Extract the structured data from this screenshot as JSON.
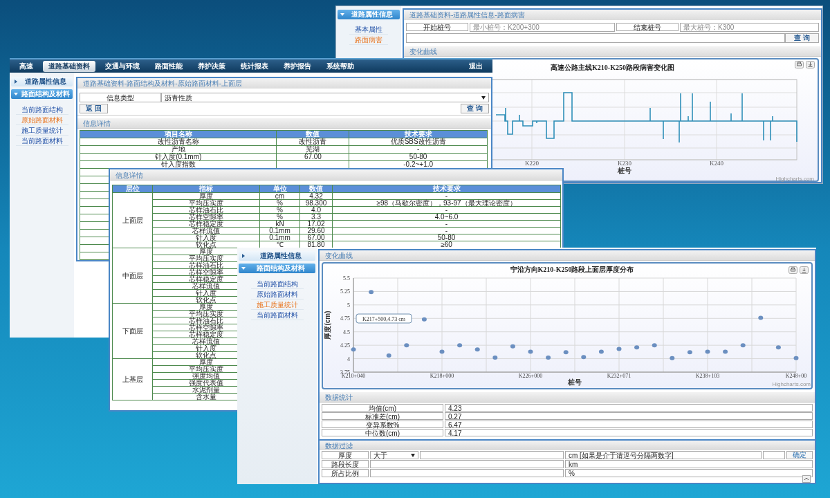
{
  "distress_window": {
    "sidebar": {
      "groups": [
        {
          "label": "道路属性信息",
          "expanded": true,
          "items": [
            {
              "label": "基本属性",
              "selected": false
            },
            {
              "label": "路面病害",
              "selected": true
            }
          ]
        }
      ]
    },
    "breadcrumb": "道路基础资料-道路属性信息-路面病害",
    "form": {
      "start_label": "开始桩号",
      "start_placeholder": "最小桩号：K200+300",
      "end_label": "结束桩号",
      "end_placeholder": "最大桩号：K300",
      "query_button": "查 询"
    },
    "section_title": "变化曲线",
    "chart": {
      "title": "高速公路主线K210-K250路段病害变化图",
      "x_labels": [
        "K220",
        "K230",
        "K240"
      ],
      "xlabel": "桩号",
      "credit": "Highcharts.com"
    }
  },
  "material_window": {
    "nav": [
      {
        "label": "高速",
        "selected": false
      },
      {
        "label": "道路基础资料",
        "selected": true
      },
      {
        "label": "交通与环境",
        "selected": false
      },
      {
        "label": "路面性能",
        "selected": false
      },
      {
        "label": "养护决策",
        "selected": false
      },
      {
        "label": "统计报表",
        "selected": false
      },
      {
        "label": "养护报告",
        "selected": false
      },
      {
        "label": "系统帮助",
        "selected": false
      }
    ],
    "logout": "退出",
    "sidebar": {
      "groups": [
        {
          "label": "道路属性信息",
          "expanded": false
        },
        {
          "label": "路面结构及材料",
          "expanded": true,
          "items": [
            {
              "label": "当前路面结构",
              "selected": false
            },
            {
              "label": "原始路面材料",
              "selected": true
            },
            {
              "label": "施工质量统计",
              "selected": false
            },
            {
              "label": "当前路面材料",
              "selected": false
            }
          ]
        }
      ]
    },
    "breadcrumb": "道路基础资料-路面结构及材料-原始路面材料-上面层",
    "filter": {
      "label": "信息类型",
      "value": "沥青性质"
    },
    "back_button": "返 回",
    "query_button": "查 询",
    "section_title": "信息详情",
    "table": {
      "columns": [
        "项目名称",
        "数值",
        "技术要求"
      ],
      "rows": [
        [
          "改性沥青名称",
          "改性沥青",
          "优质SBS改性沥青"
        ],
        [
          "产地",
          "芜湖",
          "-"
        ],
        [
          "针入度(0.1mm)",
          "67.00",
          "50-80"
        ],
        [
          "针入度指数",
          "",
          "-0.2~+1.0"
        ]
      ]
    }
  },
  "detail_window": {
    "section_title": "信息详情",
    "table": {
      "columns": [
        "层位",
        "指标",
        "单位",
        "数值",
        "技术要求"
      ],
      "groups": [
        {
          "layer": "上面层",
          "rows": [
            {
              "indicator": "厚度",
              "unit": "cm",
              "value": "4.32",
              "requirement": "-"
            },
            {
              "indicator": "平均压实度",
              "unit": "%",
              "value": "98.300",
              "requirement": "≥98（马歇尔密度），93-97（最大理论密度）"
            },
            {
              "indicator": "芯样油石比",
              "unit": "%",
              "value": "4.0",
              "requirement": "-"
            },
            {
              "indicator": "芯样空隙率",
              "unit": "%",
              "value": "3.3",
              "requirement": "4.0~6.0"
            },
            {
              "indicator": "芯样稳定度",
              "unit": "kN",
              "value": "17.02",
              "requirement": "-"
            },
            {
              "indicator": "芯样流值",
              "unit": "0.1mm",
              "value": "29.60",
              "requirement": "-"
            },
            {
              "indicator": "针入度",
              "unit": "0.1mm",
              "value": "67.00",
              "requirement": "50-80"
            },
            {
              "indicator": "软化点",
              "unit": "℃",
              "value": "81.80",
              "requirement": "≥60"
            }
          ]
        },
        {
          "layer": "中面层",
          "rows": [
            {
              "indicator": "厚度"
            },
            {
              "indicator": "平均压实度"
            },
            {
              "indicator": "芯样油石比"
            },
            {
              "indicator": "芯样空隙率"
            },
            {
              "indicator": "芯样稳定度"
            },
            {
              "indicator": "芯样流值"
            },
            {
              "indicator": "针入度"
            },
            {
              "indicator": "软化点"
            }
          ]
        },
        {
          "layer": "下面层",
          "rows": [
            {
              "indicator": "厚度"
            },
            {
              "indicator": "平均压实度"
            },
            {
              "indicator": "芯样油石比"
            },
            {
              "indicator": "芯样空隙率"
            },
            {
              "indicator": "芯样稳定度"
            },
            {
              "indicator": "芯样流值"
            },
            {
              "indicator": "针入度"
            },
            {
              "indicator": "软化点"
            }
          ]
        },
        {
          "layer": "上基层",
          "rows": [
            {
              "indicator": "厚度"
            },
            {
              "indicator": "平均压实度"
            },
            {
              "indicator": "强度均值"
            },
            {
              "indicator": "强度代表值"
            },
            {
              "indicator": "水泥剂量"
            },
            {
              "indicator": "含水量"
            }
          ]
        }
      ]
    }
  },
  "thickness_window": {
    "sidebar": {
      "groups": [
        {
          "label": "道路属性信息",
          "expanded": false
        },
        {
          "label": "路面结构及材料",
          "expanded": true,
          "items": [
            {
              "label": "当前路面结构",
              "selected": false
            },
            {
              "label": "原始路面材料",
              "selected": false
            },
            {
              "label": "施工质量统计",
              "selected": true
            },
            {
              "label": "当前路面材料",
              "selected": false
            }
          ]
        }
      ]
    },
    "section_title": "变化曲线",
    "chart_data": {
      "type": "scatter",
      "title": "宁沿方向K210-K250路段上面层厚度分布",
      "xlabel": "桩号",
      "ylabel": "厚度(cm)",
      "categories": [
        "K210+040",
        null,
        null,
        null,
        null,
        "K218+000",
        null,
        null,
        null,
        null,
        "K226+000",
        null,
        null,
        null,
        null,
        "K232+071",
        null,
        null,
        null,
        null,
        "K238+103",
        null,
        null,
        null,
        null,
        "K248+00"
      ],
      "series": [
        {
          "color": "#6b8fc0",
          "values": [
            4.17,
            5.24,
            4.06,
            4.25,
            4.73,
            4.13,
            4.25,
            4.17,
            4.02,
            4.23,
            4.13,
            4.02,
            4.12,
            4.03,
            4.13,
            4.18,
            4.21,
            4.25,
            4.01,
            4.12,
            4.13,
            4.13,
            4.25,
            4.76,
            4.21,
            4.01
          ]
        }
      ],
      "ylim": [
        3.75,
        5.5
      ],
      "grid": true,
      "yticks": [
        {
          "value": 3.75,
          "label": "3.75"
        },
        {
          "value": 4,
          "label": "4"
        },
        {
          "value": 4.25,
          "label": "4.25"
        },
        {
          "value": 4.5,
          "label": "4.5"
        },
        {
          "value": 4.75,
          "label": "4.75"
        },
        {
          "value": 5,
          "label": "5"
        },
        {
          "value": 5.25,
          "label": "5.25"
        },
        {
          "value": 5.5,
          "label": "5.5"
        }
      ],
      "annotations": [
        "K217+500,4.73 cm"
      ]
    },
    "credit": "Highcharts.com",
    "stats_title": "数据统计",
    "stats": [
      {
        "label": "均值(cm)",
        "value": "4.23"
      },
      {
        "label": "标准差(cm)",
        "value": "0.27"
      },
      {
        "label": "变异系数%",
        "value": "6.47"
      },
      {
        "label": "中位数(cm)",
        "value": "4.17"
      }
    ],
    "filter_title": "数据过滤",
    "filters": [
      {
        "label": "厚度",
        "operator": "大于",
        "unit": "cm [如果是介于请逗号分隔两数字]"
      },
      {
        "label": "路段长度",
        "unit": "km"
      },
      {
        "label": "所占比例",
        "unit": "%"
      }
    ],
    "confirm_button": "确定"
  }
}
